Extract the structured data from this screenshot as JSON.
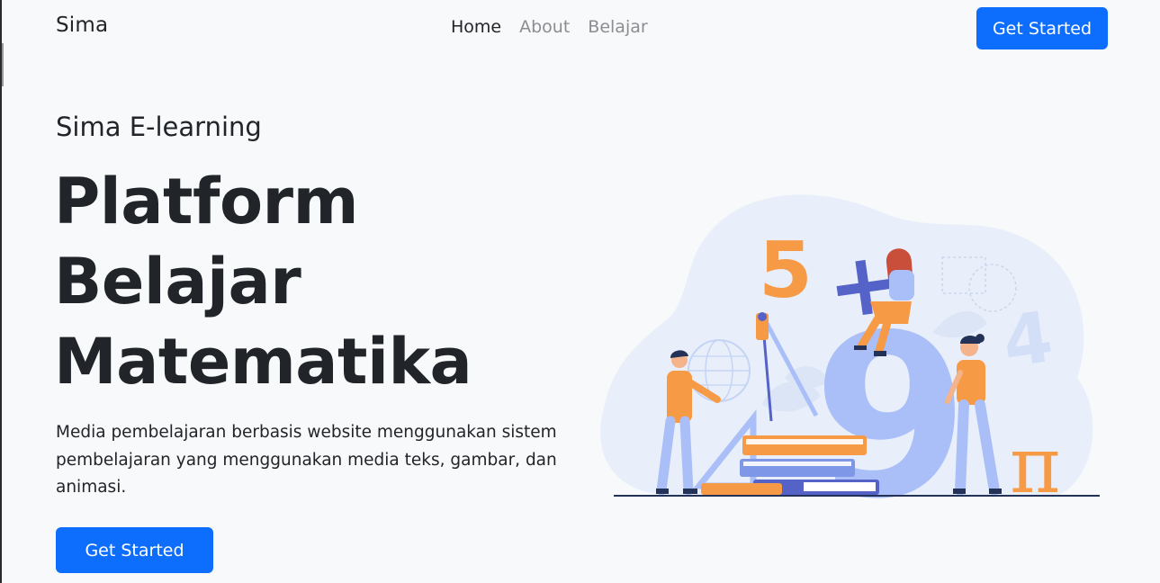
{
  "navbar": {
    "brand": "Sima",
    "links": [
      {
        "label": "Home",
        "active": true
      },
      {
        "label": "About",
        "active": false
      },
      {
        "label": "Belajar",
        "active": false
      }
    ],
    "cta_label": "Get Started"
  },
  "hero": {
    "subtitle": "Sima E-learning",
    "headline_lines": [
      "Platform",
      "Belajar",
      "Matematika"
    ],
    "description": "Media pembelajaran berbasis website menggunakan sistem pembelajaran yang menggunakan media teks, gambar, dan animasi.",
    "cta_label": "Get Started"
  },
  "illustration": {
    "glyphs": {
      "five": "5",
      "plus": "+",
      "nine": "9",
      "four": "4",
      "pi": "π"
    }
  },
  "colors": {
    "primary": "#0d6efd",
    "background": "#f8f9fa",
    "text": "#212529",
    "nav_muted": "#8a8d91",
    "illustration_orange": "#f79a45",
    "illustration_blue": "#aabff8",
    "illustration_indigo": "#5563c8",
    "illustration_blob": "#e8effa"
  }
}
